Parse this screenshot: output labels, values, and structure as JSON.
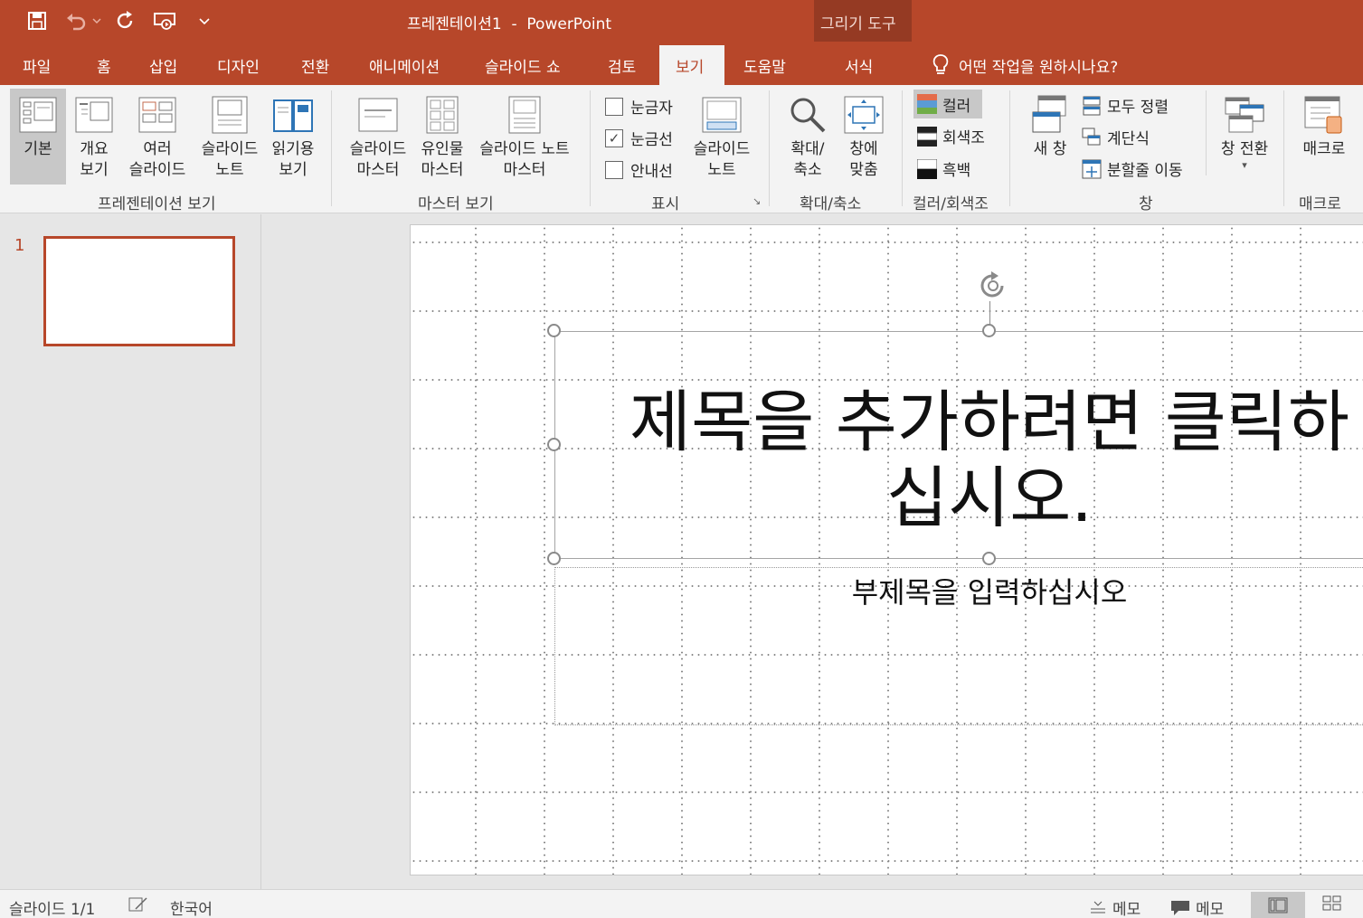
{
  "titlebar": {
    "title": "프레젠테이션1  -  PowerPoint",
    "context_tool": "그리기 도구",
    "bg_color": "#b7472a"
  },
  "tabs": [
    {
      "label": "파일"
    },
    {
      "label": "홈"
    },
    {
      "label": "삽입"
    },
    {
      "label": "디자인"
    },
    {
      "label": "전환"
    },
    {
      "label": "애니메이션"
    },
    {
      "label": "슬라이드 쇼"
    },
    {
      "label": "검토"
    },
    {
      "label": "보기",
      "active": true
    },
    {
      "label": "도움말"
    },
    {
      "label": "서식"
    }
  ],
  "tell_me": "어떤 작업을 원하시나요?",
  "ribbon": {
    "pres_view": {
      "normal": [
        "기본"
      ],
      "outline": [
        "개요",
        "보기"
      ],
      "sorter": [
        "여러",
        "슬라이드"
      ],
      "notes": [
        "슬라이드",
        "노트"
      ],
      "reading": [
        "읽기용",
        "보기"
      ],
      "group": "프레젠테이션 보기"
    },
    "master_view": {
      "slide_master": [
        "슬라이드",
        "마스터"
      ],
      "handout_master": [
        "유인물",
        "마스터"
      ],
      "notes_master": [
        "슬라이드 노트",
        "마스터"
      ],
      "group": "마스터 보기"
    },
    "show": {
      "ruler": "눈금자",
      "gridlines": "눈금선",
      "guides": "안내선",
      "notes": [
        "슬라이드",
        "노트"
      ],
      "group": "표시",
      "gridlines_checked": true,
      "ruler_checked": false,
      "guides_checked": false
    },
    "zoom": {
      "zoom": [
        "확대/",
        "축소"
      ],
      "fit": [
        "창에",
        "맞춤"
      ],
      "group": "확대/축소"
    },
    "color": {
      "color": "컬러",
      "grayscale": "회색조",
      "bw": "흑백",
      "group": "컬러/회색조"
    },
    "window": {
      "new_window": "새 창",
      "arrange_all": "모두 정렬",
      "cascade": "계단식",
      "move_split": "분할줄 이동",
      "switch": "창 전환",
      "group": "창"
    },
    "macros": {
      "macro": "매크로",
      "group": "매크로"
    }
  },
  "thumbnails": {
    "slide_number": "1"
  },
  "slide": {
    "title_line1": "제목을 추가하려면 클릭하",
    "title_line2": "십시오.",
    "subtitle": "부제목을 입력하십시오"
  },
  "statusbar": {
    "slide_info": "슬라이드 1/1",
    "language": "한국어",
    "notes": "메모",
    "comments": "메모"
  }
}
